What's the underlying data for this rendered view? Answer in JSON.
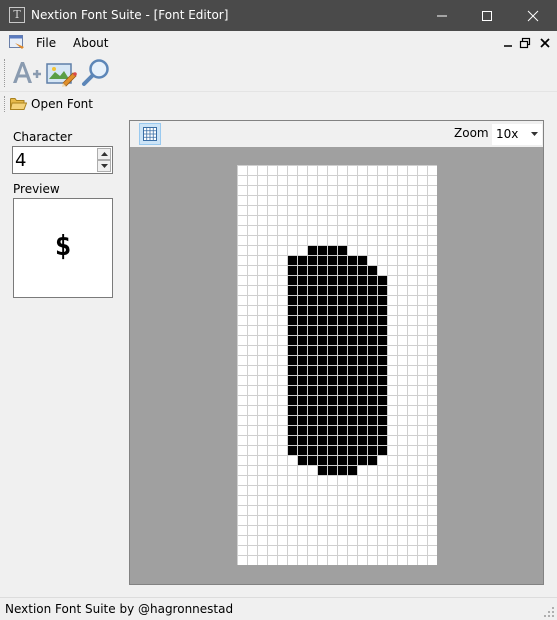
{
  "window": {
    "title": "Nextion Font Suite - [Font Editor]",
    "app_icon_letter": "T"
  },
  "menu": {
    "items": [
      "File",
      "About"
    ]
  },
  "open_font": {
    "label": "Open Font"
  },
  "character": {
    "label": "Character",
    "value": "4"
  },
  "preview": {
    "label": "Preview",
    "glyph": "$"
  },
  "zoom": {
    "label": "Zoom",
    "value": "10x"
  },
  "status": {
    "text": "Nextion Font Suite by @hagronnestad"
  },
  "glyph_bitmap": {
    "cols": 20,
    "rows": 40,
    "rows_data": [
      "00000000000000000000",
      "00000000000000000000",
      "00000000000000000000",
      "00000000000000000000",
      "00000000000000000000",
      "00000000000000000000",
      "00000000000000000000",
      "00000000000000000000",
      "00000001111000000000",
      "00000111111110000000",
      "00000111111111000000",
      "00000111111111100000",
      "00000111111111100000",
      "00000111111111100000",
      "00000111111111100000",
      "00000111111111100000",
      "00000111111111100000",
      "00000111111111100000",
      "00000111111111100000",
      "00000111111111100000",
      "00000111111111100000",
      "00000111111111100000",
      "00000111111111100000",
      "00000111111111100000",
      "00000111111111100000",
      "00000111111111100000",
      "00000111111111100000",
      "00000111111111100000",
      "00000111111111100000",
      "00000011111111000000",
      "00000000111100000000",
      "00000000000000000000",
      "00000000000000000000",
      "00000000000000000000",
      "00000000000000000000",
      "00000000000000000000",
      "00000000000000000000",
      "00000000000000000000",
      "00000000000000000000",
      "00000000000000000000"
    ]
  },
  "colors": {
    "titlebar": "#4a4a4a",
    "canvas_bg": "#a0a0a0",
    "pixel_on": "#000000",
    "pixel_off": "#ffffff",
    "grid_line": "#cfcfcf"
  },
  "icons": {
    "app": "font-tool-icon",
    "add_font": "add-font-icon",
    "edit_image": "edit-image-icon",
    "search": "magnifier-icon",
    "open_font": "folder-icon",
    "grid_toggle": "grid-icon"
  }
}
